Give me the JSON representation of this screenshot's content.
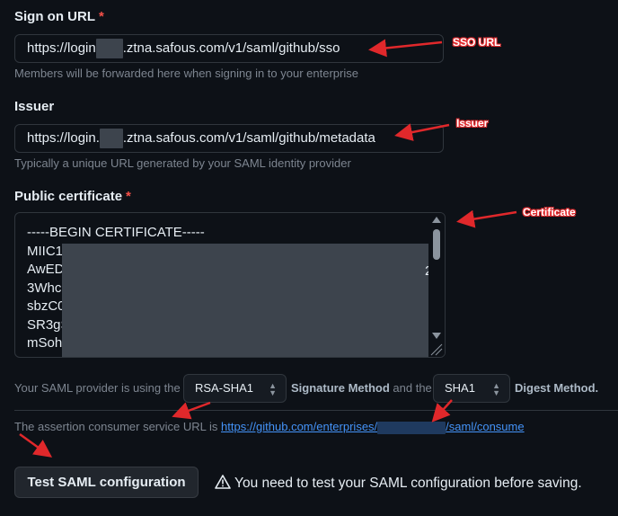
{
  "sign_on_url": {
    "label": "Sign on URL",
    "required_mark": "*",
    "value_prefix": "https://login",
    "value_suffix": ".ztna.safous.com/v1/saml/github/sso",
    "hint": "Members will be forwarded here when signing in to your enterprise"
  },
  "issuer": {
    "label": "Issuer",
    "value_prefix": "https://login.",
    "value_suffix": ".ztna.safous.com/v1/saml/github/metadata",
    "hint": "Typically a unique URL generated by your SAML identity provider"
  },
  "public_certificate": {
    "label": "Public certificate",
    "required_mark": "*",
    "lines": [
      "-----BEGIN CERTIFICATE-----",
      "MIIC1",
      "AwED",
      "3Whc",
      "sbzC0",
      "SR3gS",
      "mSoh"
    ],
    "trailing_char": "2"
  },
  "signature": {
    "text_prefix": "Your SAML provider is using the",
    "signature_select_value": "RSA-SHA1",
    "signature_method_label": "Signature Method",
    "and_the": "and the",
    "digest_select_value": "SHA1",
    "digest_method_label": "Digest Method."
  },
  "acs": {
    "text": "The assertion consumer service URL is",
    "link_prefix": "https://github.com/enterprises/",
    "link_suffix": "/saml/consume"
  },
  "test_button": {
    "label": "Test SAML configuration"
  },
  "warning": {
    "icon": "alert-icon",
    "text": "You need to test your SAML configuration before saving."
  },
  "annotations": {
    "sso_url": "SSO URL",
    "issuer": "Issuer",
    "certificate": "Certificate"
  },
  "colors": {
    "annotation_red": "#e0282b",
    "link_blue": "#4493f8",
    "required_red": "#f85149"
  }
}
